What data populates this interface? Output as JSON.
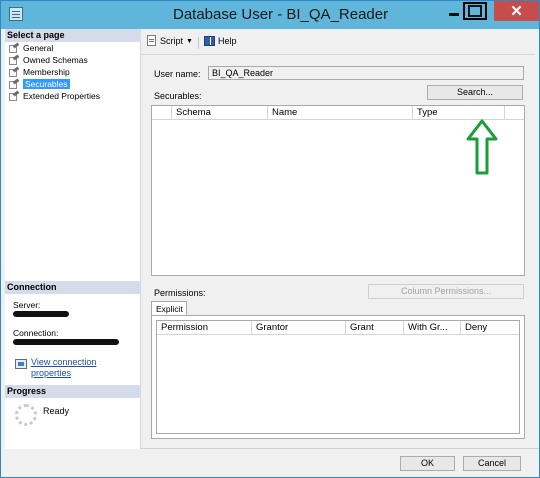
{
  "window": {
    "title": "Database User - BI_QA_Reader",
    "close_glyph": "✕"
  },
  "left_pane": {
    "select_page_header": "Select a page",
    "pages": [
      {
        "label": "General"
      },
      {
        "label": "Owned Schemas"
      },
      {
        "label": "Membership"
      },
      {
        "label": "Securables",
        "selected": true
      },
      {
        "label": "Extended Properties"
      }
    ],
    "connection_header": "Connection",
    "server_label": "Server:",
    "connection_label": "Connection:",
    "view_connection_link": "View connection properties",
    "progress_header": "Progress",
    "progress_status": "Ready"
  },
  "toolbar": {
    "script_label": "Script",
    "script_caret": "▼",
    "help_label": "Help"
  },
  "form": {
    "user_name_label": "User name:",
    "user_name_value": "BI_QA_Reader",
    "securables_label": "Securables:",
    "search_button": "Search...",
    "securables_columns": [
      "Schema",
      "Name",
      "Type"
    ],
    "permissions_label": "Permissions:",
    "column_permissions_button": "Column Permissions...",
    "tab_explicit": "Explicit",
    "permissions_columns": [
      "Permission",
      "Grantor",
      "Grant",
      "With Gr...",
      "Deny"
    ]
  },
  "footer": {
    "ok_button": "OK",
    "cancel_button": "Cancel"
  },
  "colors": {
    "titlebar": "#5fb6da",
    "close_button": "#c74d4d",
    "selection": "#3399ff",
    "annotation_arrow": "#1a9e3a"
  }
}
